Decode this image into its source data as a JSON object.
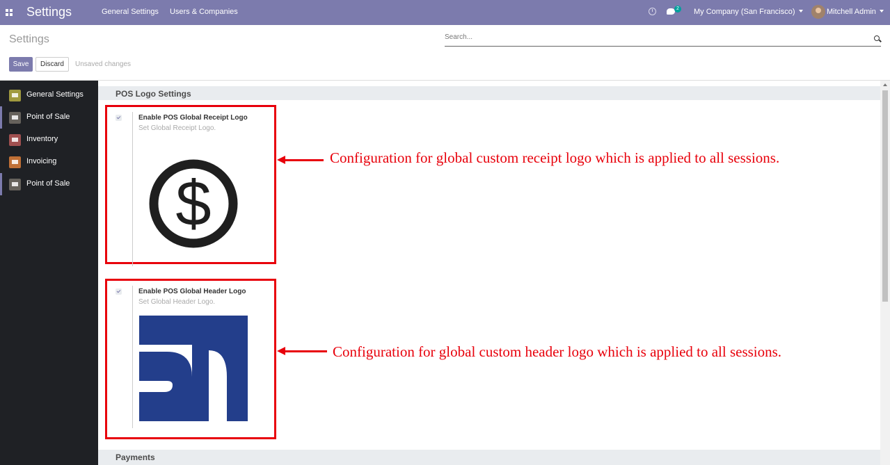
{
  "navbar": {
    "app_title": "Settings",
    "menu": [
      "General Settings",
      "Users & Companies"
    ],
    "chat_count": "2",
    "company": "My Company (San Francisco)",
    "user": "Mitchell Admin",
    "color": "#7c7bad"
  },
  "control_panel": {
    "title": "Settings",
    "search_placeholder": "Search...",
    "save_label": "Save",
    "discard_label": "Discard",
    "status": "Unsaved changes"
  },
  "sidebar": {
    "items": [
      {
        "label": "General Settings",
        "icon": "gear-icon",
        "color": "#a09a3f"
      },
      {
        "label": "Point of Sale",
        "icon": "store-icon",
        "color": "#66625c"
      },
      {
        "label": "Inventory",
        "icon": "boxes-icon",
        "color": "#a05050"
      },
      {
        "label": "Invoicing",
        "icon": "invoice-icon",
        "color": "#c07036"
      },
      {
        "label": "Point of Sale",
        "icon": "store-icon",
        "color": "#66625c"
      }
    ]
  },
  "sections": {
    "pos_logo": "POS Logo Settings",
    "payments": "Payments"
  },
  "settings": {
    "receipt": {
      "title": "Enable POS Global Receipt Logo",
      "description": "Set Global Receipt Logo.",
      "checked": true,
      "logo": "dollar-coin-logo"
    },
    "header": {
      "title": "Enable POS Global Header Logo",
      "description": "Set Global Header Logo.",
      "checked": true,
      "logo": "sh-monogram-logo",
      "logo_color": "#233e8b"
    }
  },
  "annotations": {
    "receipt": "Configuration for global custom receipt logo which is applied to all sessions.",
    "header": "Configuration for global custom header logo which is applied to all sessions.",
    "color": "#e8000b"
  }
}
